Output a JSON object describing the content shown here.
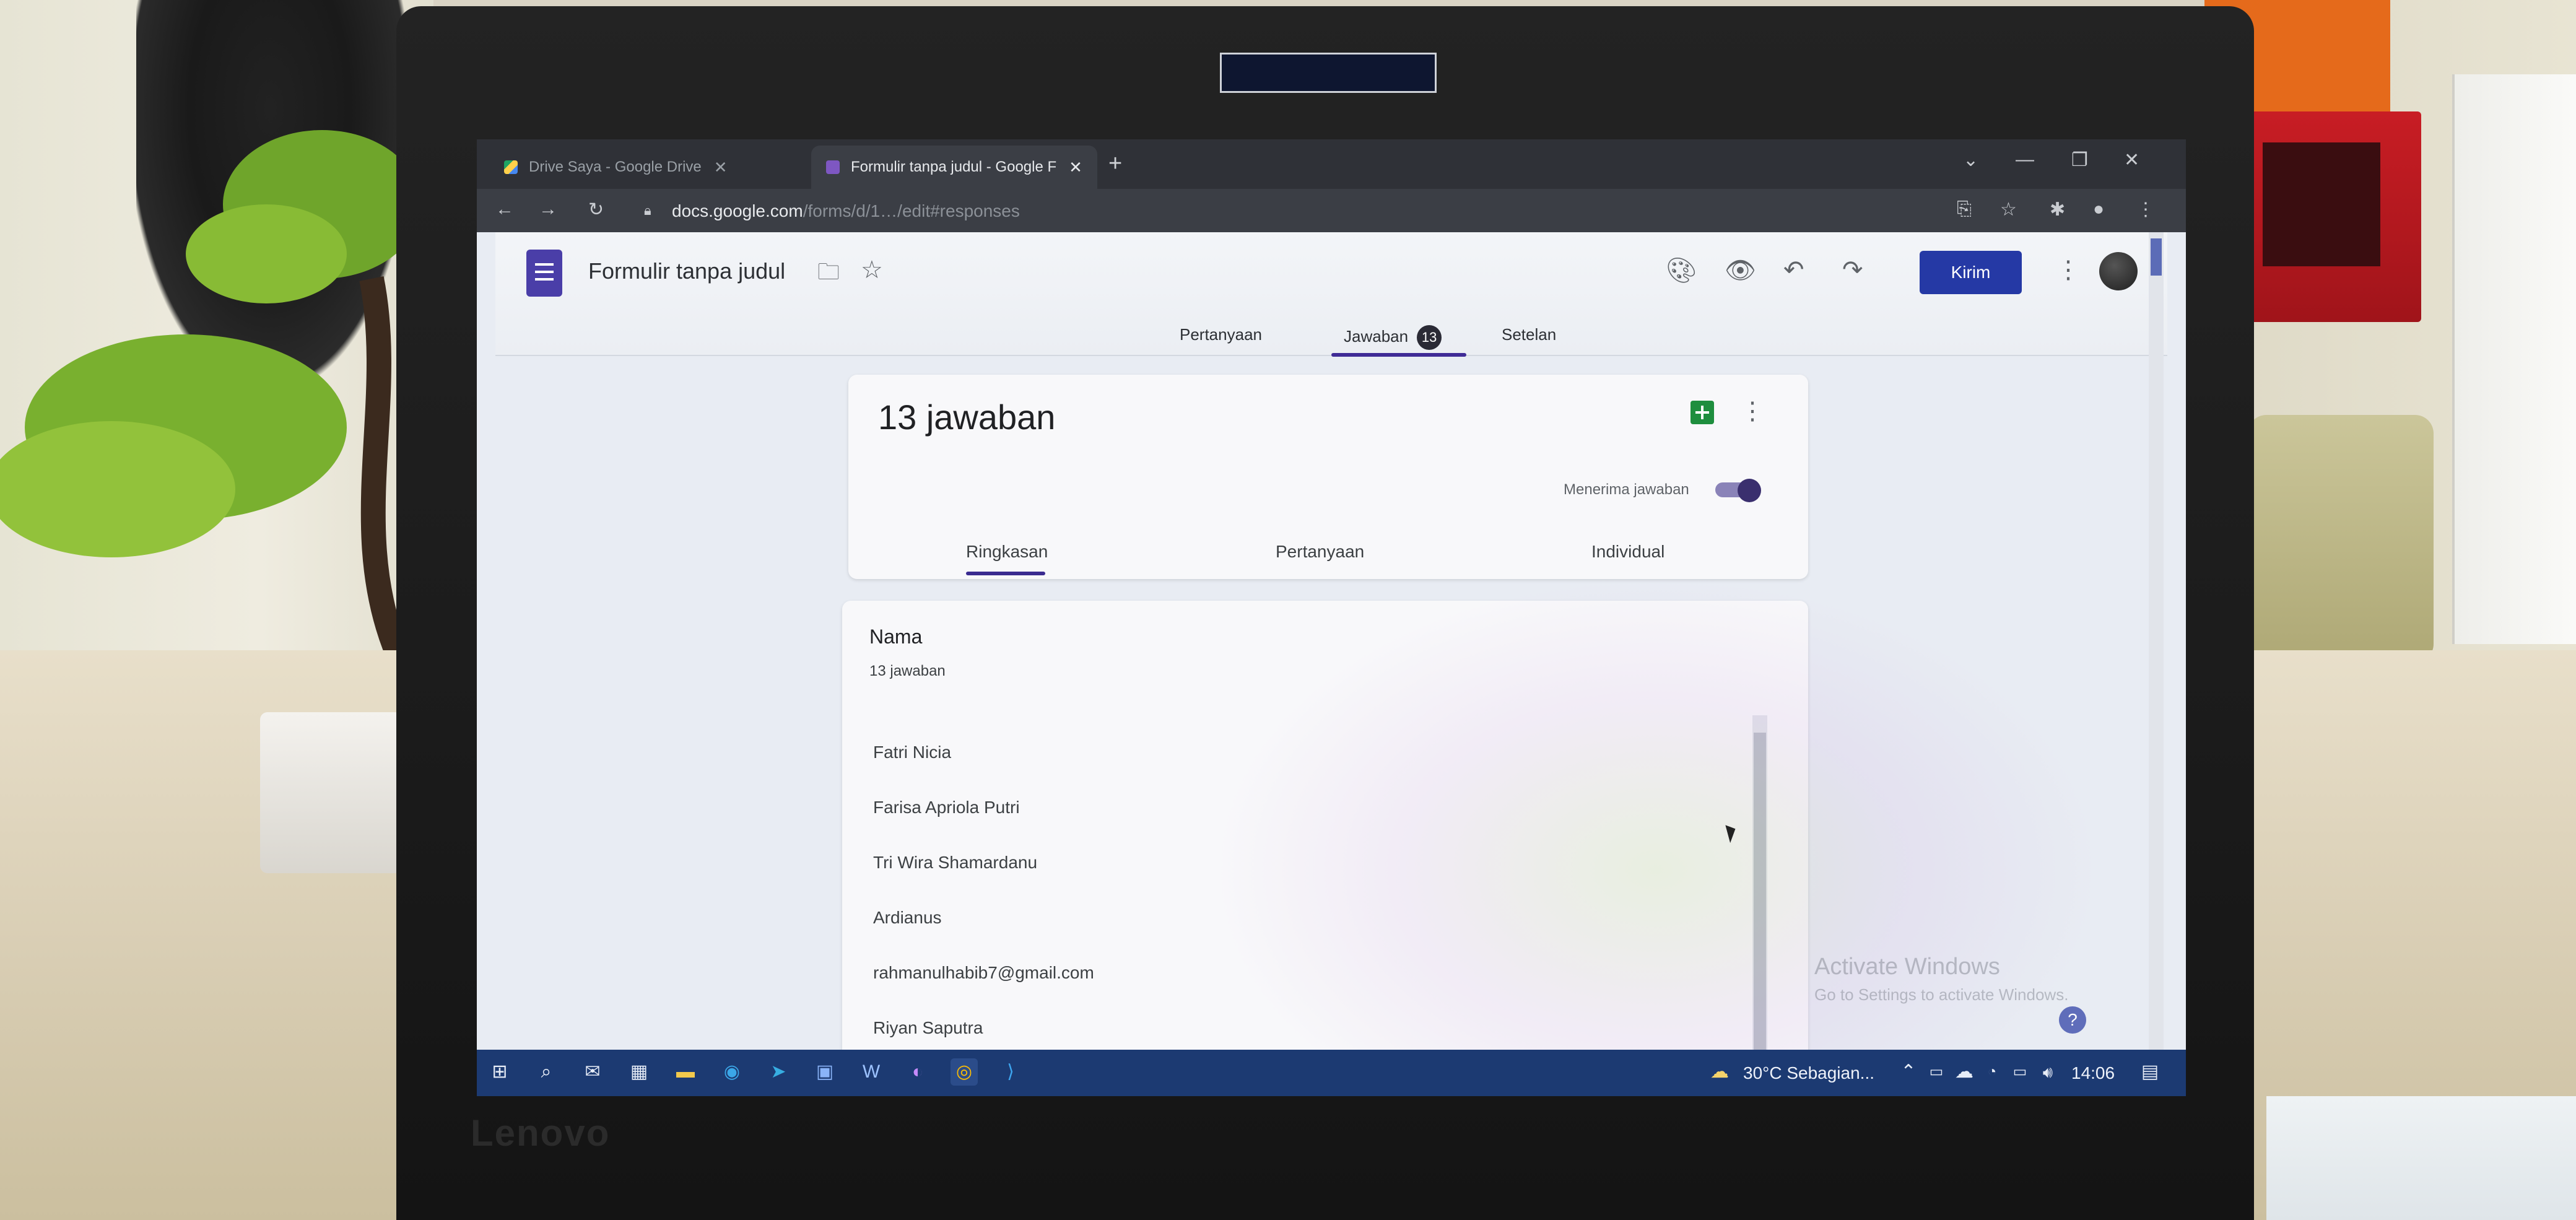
{
  "browser": {
    "tabs": [
      {
        "label": "Drive Saya - Google Drive",
        "active": false
      },
      {
        "label": "Formulir tanpa judul - Google F",
        "active": true
      }
    ],
    "address": "docs.google.com",
    "address_rest": "/forms/d/1…/edit#responses"
  },
  "forms": {
    "title": "Formulir tanpa judul",
    "send_label": "Kirim",
    "tabs": {
      "questions": "Pertanyaan",
      "responses": "Jawaban",
      "responses_badge": "13",
      "settings": "Setelan"
    }
  },
  "summary": {
    "count_title": "13 jawaban",
    "accepting_label": "Menerima jawaban",
    "accepting": true,
    "subtabs": [
      "Ringkasan",
      "Pertanyaan",
      "Individual"
    ]
  },
  "question": {
    "title": "Nama",
    "count": "13 jawaban",
    "answers": [
      "Fatri Nicia",
      "Farisa Apriola Putri",
      "Tri Wira Shamardanu",
      "Ardianus",
      "rahmanulhabib7@gmail.com",
      "Riyan Saputra"
    ]
  },
  "watermark": {
    "title": "Activate Windows",
    "subtitle": "Go to Settings to activate Windows."
  },
  "taskbar": {
    "weather": "30°C  Sebagian...",
    "time": "14:06"
  },
  "device": {
    "brand": "Lenovo"
  },
  "colors": {
    "accent": "#2539a5",
    "forms_purple": "#4a3ea8",
    "taskbar": "#1c3a72"
  }
}
